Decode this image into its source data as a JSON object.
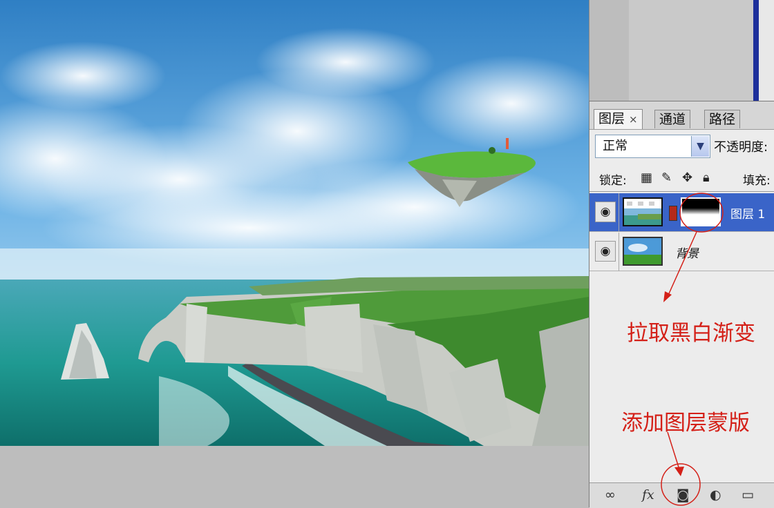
{
  "panel": {
    "tabs": [
      {
        "label": "图层",
        "close": "×"
      },
      {
        "label": "通道"
      },
      {
        "label": "路径"
      }
    ],
    "blend_mode": "正常",
    "opacity_label": "不透明度:",
    "lock_label": "锁定:",
    "fill_label": "填充:",
    "layers": [
      {
        "name": "图层 1",
        "selected": true
      },
      {
        "name": "背景",
        "selected": false
      }
    ]
  },
  "annotations": {
    "gradient_tip": "拉取黑白渐变",
    "mask_tip": "添加图层蒙版"
  },
  "colors": {
    "annotation": "#d42018",
    "selected_layer": "#3a64c8"
  },
  "icons": [
    "eye-icon",
    "link-icon",
    "fx-icon",
    "layer-mask-icon",
    "adjustment-layer-icon",
    "new-group-icon",
    "lock-transparent-icon",
    "lock-brush-icon",
    "lock-move-icon",
    "lock-all-icon",
    "dropdown-arrow-icon"
  ]
}
